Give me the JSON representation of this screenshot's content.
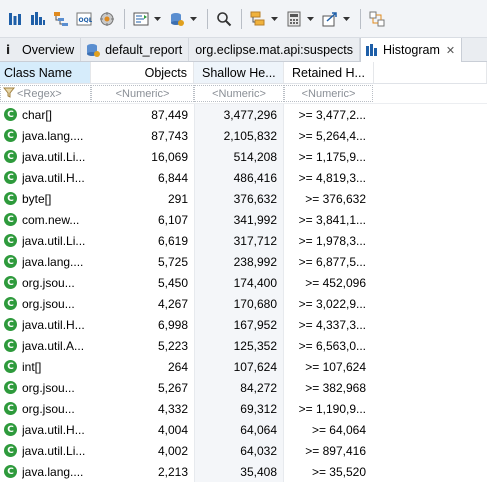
{
  "toolbar": {
    "icons": [
      "overview-icon",
      "histogram-icon",
      "dominator-tree-icon",
      "oql-icon",
      "thread-overview-icon",
      "query-browser-icon",
      "heap-dump-overview-icon",
      "search-icon",
      "group-by-icon",
      "calculator-icon",
      "export-icon",
      "pin-icon"
    ]
  },
  "tabs": [
    {
      "label": "Overview",
      "icon": "info-icon",
      "active": false
    },
    {
      "label": "default_report",
      "icon": "report-icon",
      "active": false
    },
    {
      "label": "org.eclipse.mat.api:suspects",
      "icon": "none",
      "active": false
    },
    {
      "label": "Histogram",
      "icon": "histogram-icon",
      "active": true,
      "close": "✕"
    }
  ],
  "table": {
    "columns": [
      "Class Name",
      "Objects",
      "Shallow He...",
      "Retained H..."
    ],
    "filters": [
      "<Regex>",
      "<Numeric>",
      "<Numeric>",
      "<Numeric>"
    ],
    "rows": [
      {
        "name": "char[]",
        "objects": "87,449",
        "shallow": "3,477,296",
        "retained": ">= 3,477,2..."
      },
      {
        "name": "java.lang....",
        "objects": "87,743",
        "shallow": "2,105,832",
        "retained": ">= 5,264,4..."
      },
      {
        "name": "java.util.Li...",
        "objects": "16,069",
        "shallow": "514,208",
        "retained": ">= 1,175,9..."
      },
      {
        "name": "java.util.H...",
        "objects": "6,844",
        "shallow": "486,416",
        "retained": ">= 4,819,3..."
      },
      {
        "name": "byte[]",
        "objects": "291",
        "shallow": "376,632",
        "retained": ">= 376,632"
      },
      {
        "name": "com.new...",
        "objects": "6,107",
        "shallow": "341,992",
        "retained": ">= 3,841,1..."
      },
      {
        "name": "java.util.Li...",
        "objects": "6,619",
        "shallow": "317,712",
        "retained": ">= 1,978,3..."
      },
      {
        "name": "java.lang....",
        "objects": "5,725",
        "shallow": "238,992",
        "retained": ">= 6,877,5..."
      },
      {
        "name": "org.jsou...",
        "objects": "5,450",
        "shallow": "174,400",
        "retained": ">= 452,096"
      },
      {
        "name": "org.jsou...",
        "objects": "4,267",
        "shallow": "170,680",
        "retained": ">= 3,022,9..."
      },
      {
        "name": "java.util.H...",
        "objects": "6,998",
        "shallow": "167,952",
        "retained": ">= 4,337,3..."
      },
      {
        "name": "java.util.A...",
        "objects": "5,223",
        "shallow": "125,352",
        "retained": ">= 6,563,0..."
      },
      {
        "name": "int[]",
        "objects": "264",
        "shallow": "107,624",
        "retained": ">= 107,624"
      },
      {
        "name": "org.jsou...",
        "objects": "5,267",
        "shallow": "84,272",
        "retained": ">= 382,968"
      },
      {
        "name": "org.jsou...",
        "objects": "4,332",
        "shallow": "69,312",
        "retained": ">= 1,190,9..."
      },
      {
        "name": "java.util.H...",
        "objects": "4,004",
        "shallow": "64,064",
        "retained": ">= 64,064"
      },
      {
        "name": "java.util.Li...",
        "objects": "4,002",
        "shallow": "64,032",
        "retained": ">= 897,416"
      },
      {
        "name": "java.lang....",
        "objects": "2,213",
        "shallow": "35,408",
        "retained": ">= 35,520"
      }
    ]
  },
  "colors": {
    "class_icon": "#2e9a3c",
    "header_selected": "#d6ecfb",
    "sorted_column_bg": "#f4f6f9"
  }
}
